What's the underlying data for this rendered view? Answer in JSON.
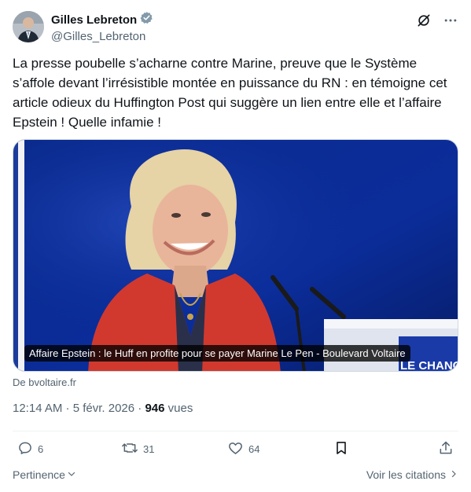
{
  "author": {
    "display_name": "Gilles Lebreton",
    "handle": "@Gilles_Lebreton"
  },
  "tweet": {
    "text": "La presse poubelle s’acharne contre Marine, preuve que le Système s’affole devant l’irrésistible montée en puissance du RN : en témoigne cet article odieux du Huffington Post qui suggère un lien entre elle et l’affaire Epstein ! Quelle infamie !"
  },
  "media": {
    "caption": "Affaire Epstein : le Huff en profite pour se payer Marine Le Pen - Boulevard Voltaire",
    "source": "De bvoltaire.fr",
    "banner_text": "LE CHANGE"
  },
  "meta": {
    "time_date": "12:14 AM · 5 févr. 2026 · ",
    "views_count": "946",
    "views_label": " vues"
  },
  "actions": {
    "replies": "6",
    "reposts": "31",
    "likes": "64"
  },
  "footer": {
    "relevance_label": "Pertinence",
    "quotes_label": "Voir les citations"
  },
  "colors": {
    "text_primary": "#0f1419",
    "text_secondary": "#536471",
    "verified_badge": "#829aab",
    "stage_blue": "#0b2a8a"
  },
  "icons": {
    "verified": "verified-badge-icon",
    "grok": "grok-icon",
    "more": "more-icon",
    "reply": "reply-icon",
    "repost": "repost-icon",
    "like": "like-icon",
    "bookmark": "bookmark-icon",
    "share": "share-icon",
    "chevron_down": "chevron-down-icon",
    "chevron_right": "chevron-right-icon"
  }
}
